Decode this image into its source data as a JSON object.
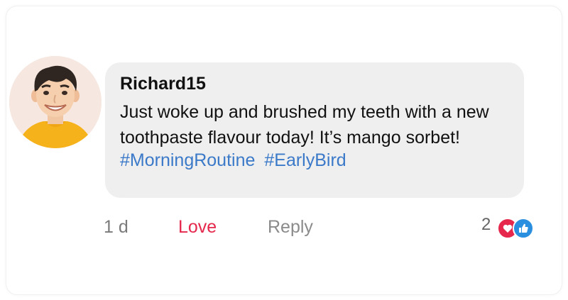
{
  "comment": {
    "author": "Richard15",
    "text": "Just woke up and brushed my teeth with a new toothpaste flavour today! It’s mango sorbet!",
    "hashtags": [
      "#MorningRoutine",
      "#EarlyBird"
    ]
  },
  "actions": {
    "time": "1 d",
    "love_label": "Love",
    "reply_label": "Reply",
    "reaction_count": "2"
  },
  "icons": {
    "heart": "heart-icon",
    "like": "thumbs-up-icon"
  },
  "colors": {
    "love": "#e5284c",
    "hashtag": "#3b79c9",
    "like": "#2b8fe0",
    "bubble": "#efefef"
  }
}
